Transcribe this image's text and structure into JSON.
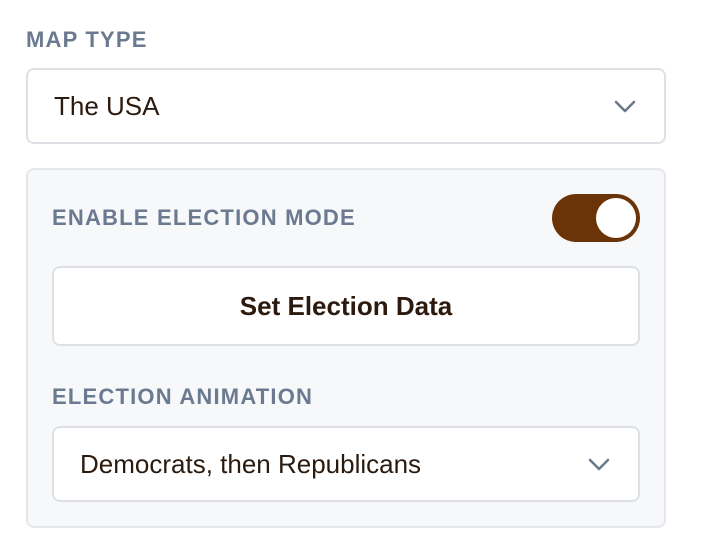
{
  "map_type": {
    "label": "MAP TYPE",
    "selected": "The USA",
    "icon": "chevron-down-icon"
  },
  "election_panel": {
    "enable_label": "ENABLE ELECTION MODE",
    "enabled": true,
    "toggle_color": "#6b3408",
    "set_data_button": "Set Election Data",
    "animation_label": "ELECTION ANIMATION",
    "animation_selected": "Democrats, then Republicans",
    "icon": "chevron-down-icon"
  },
  "colors": {
    "label": "#6b7a90",
    "text": "#2b1a0d",
    "border": "#dde1e6",
    "panel_bg": "#f7f8fa"
  }
}
